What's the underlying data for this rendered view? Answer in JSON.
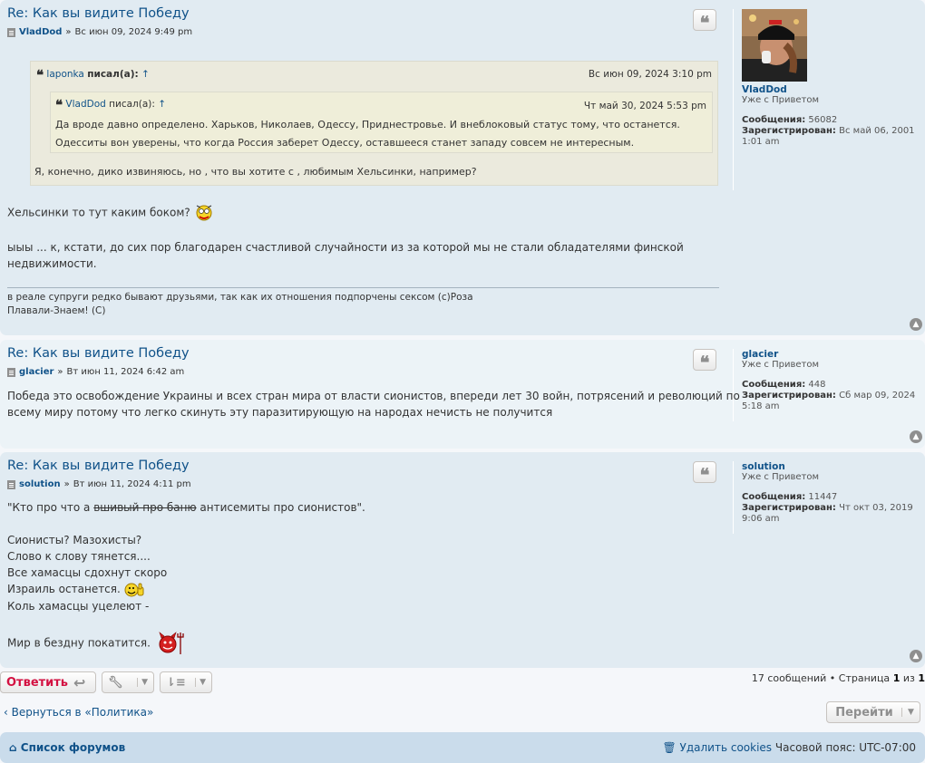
{
  "posts": [
    {
      "title": "Re: Как вы видите Победу",
      "author": "VladDod",
      "date": "Вс июн 09, 2024 9:49 pm",
      "outer_quote": {
        "author": "laponka",
        "wrote": "писал(а):",
        "date": "Вс июн 09, 2024 3:10 pm",
        "inner_quote": {
          "author": "VladDod",
          "wrote": "писал(а):",
          "date": "Чт май 30, 2024 5:53 pm",
          "text1": "Да вроде давно определено. Харьков, Николаев, Одессу, Приднестровье. И внеблоковый статус тому, что останется.",
          "text2": "Одесситы вон уверены, что когда Россия заберет Одессу, оставшееся станет западу совсем не интересным."
        },
        "text": "Я, конечно, дико извиняюсь, но , что вы хотите с , любимым Хельсинки, например?"
      },
      "line1": "Хельсинки то тут каким боком?",
      "line2a": "ыыы ... к, кстати, до сих пор благодарен счастливой случайности из за которой мы не стали обладателями финской",
      "line2b": "недвижимости.",
      "sig1": "в реале супруги редко бывают друзьями, так как их отношения подпорчены сексом (с)Роза",
      "sig2": "Плавали-Знаем! (С)",
      "profile": {
        "name": "VladDod",
        "rank": "Уже с Приветом",
        "posts_label": "Сообщения:",
        "posts": "56082",
        "reg_label": "Зарегистрирован:",
        "reg": "Вс май 06, 2001",
        "reg2": "1:01 am"
      }
    },
    {
      "title": "Re: Как вы видите Победу",
      "author": "glacier",
      "date": "Вт июн 11, 2024 6:42 am",
      "line1": "Победа это освобождение Украины и всех стран мира от власти сионистов, впереди лет 30 войн, потрясений и революций по",
      "line2": "всему миру потому что легко скинуть эту паразитирующую на народах нечисть не получится",
      "profile": {
        "name": "glacier",
        "rank": "Уже с Приветом",
        "posts_label": "Сообщения:",
        "posts": "448",
        "reg_label": "Зарегистрирован:",
        "reg": "Сб мар 09, 2024",
        "reg2": "5:18 am"
      }
    },
    {
      "title": "Re: Как вы видите Победу",
      "author": "solution",
      "date": "Вт июн 11, 2024 4:11 pm",
      "quote_open": "\"Кто про что а",
      "strike": "вшивый про баню",
      "quote_close": "антисемиты про сионистов\".",
      "lines": [
        "Сионисты? Мазохисты?",
        "Слово к слову тянется....",
        "Все хамасцы сдохнут скоро",
        "Израиль останется.",
        "Коль хамасцы уцелеют -",
        "Мир в бездну покатится."
      ],
      "profile": {
        "name": "solution",
        "rank": "Уже с Приветом",
        "posts_label": "Сообщения:",
        "posts": "11447",
        "reg_label": "Зарегистрирован:",
        "reg": "Чт окт 03, 2019",
        "reg2": "9:06 am"
      }
    }
  ],
  "actions": {
    "reply": "Ответить"
  },
  "pagination": {
    "count": "17 сообщений",
    "sep": "•",
    "page_word": "Страница",
    "current": "1",
    "of": "из",
    "total": "1"
  },
  "return_link": "Вернуться в «Политика»",
  "goto_label": "Перейти",
  "footer": {
    "home": "Список форумов",
    "delete_cookies": "Удалить cookies",
    "timezone": "Часовой пояс: UTC-07:00"
  },
  "colors": {
    "link": "#105289",
    "reply_red": "#d31141",
    "post_bg_a": "#e1ebf2",
    "post_bg_b": "#ecf3f7"
  },
  "icons": [
    "document-icon",
    "quote-icon",
    "back-to-top-icon",
    "reply-arrow-icon",
    "wrench-icon",
    "sort-icon",
    "home-icon",
    "trash-icon",
    "chevron-left-icon",
    "caret-down-icon"
  ]
}
